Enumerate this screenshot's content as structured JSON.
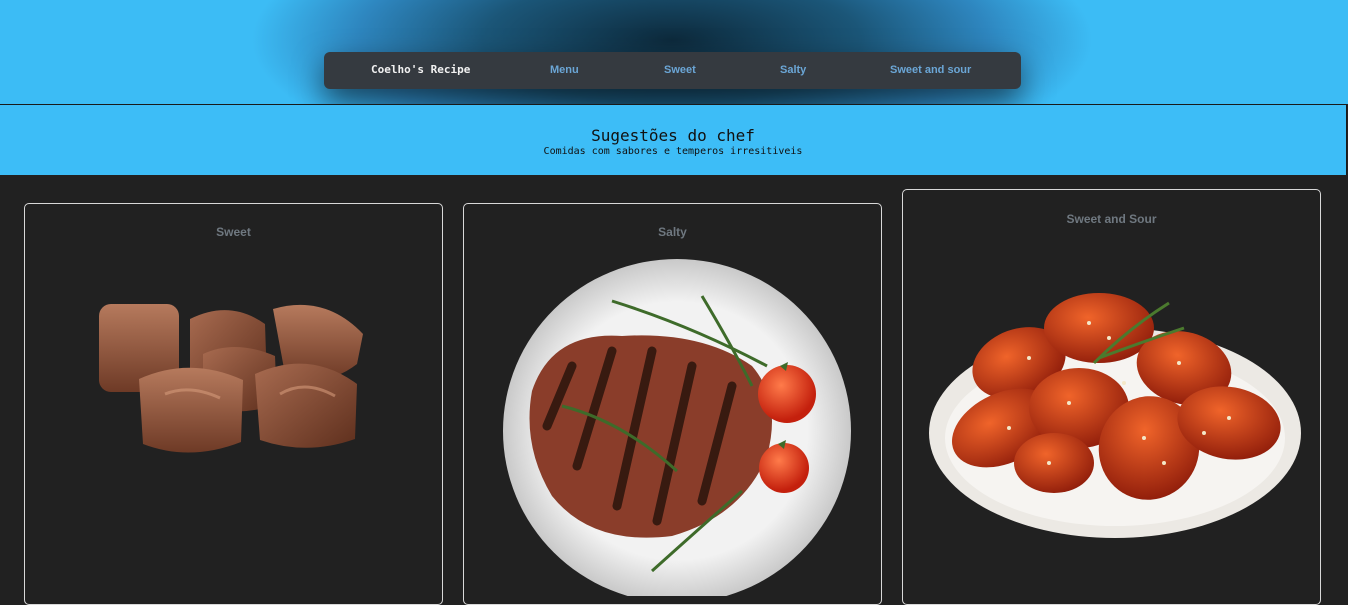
{
  "nav": {
    "brand": "Coelho's Recipe",
    "links": [
      "Menu",
      "Sweet",
      "Salty",
      "Sweet and sour"
    ]
  },
  "banner": {
    "title": "Sugestões do chef",
    "subtitle": "Comidas com sabores e temperos irresitiveis"
  },
  "cards": [
    {
      "title": "Sweet",
      "image": "chocolates-image"
    },
    {
      "title": "Salty",
      "image": "steak-plate-image"
    },
    {
      "title": "Sweet and Sour",
      "image": "chicken-wings-image"
    }
  ]
}
